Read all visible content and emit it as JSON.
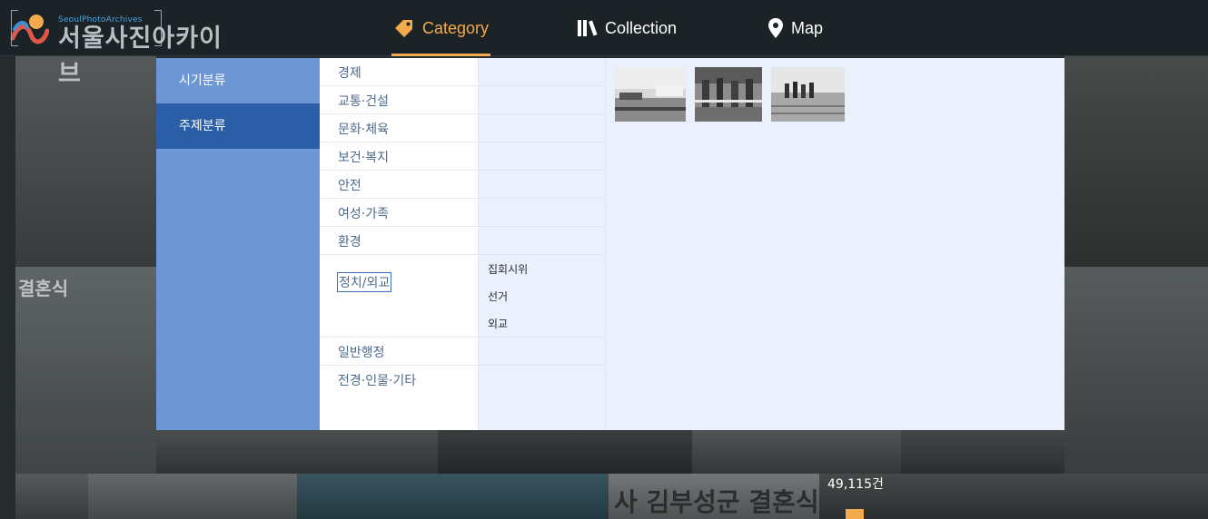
{
  "header": {
    "logo_small": "SeoulPhotoArchives",
    "logo_big": "서울사진아카이브",
    "nav": [
      {
        "label": "Category",
        "icon": "tag-icon",
        "active": true
      },
      {
        "label": "Collection",
        "icon": "books-icon",
        "active": false
      },
      {
        "label": "Map",
        "icon": "map-pin-icon",
        "active": false
      }
    ]
  },
  "dropdown": {
    "classifications": [
      "시기분류",
      "주제분류"
    ],
    "active_classification": "주제분류",
    "categories": [
      "경제",
      "교통·건설",
      "문화·체육",
      "보건·복지",
      "안전",
      "여성·가족",
      "환경",
      "정치/외교",
      "일반행정",
      "전경·인물·기타"
    ],
    "selected_category": "정치/외교",
    "subcategories": [
      "집회시위",
      "선거",
      "외교"
    ],
    "thumbnails": [
      "thumbnail-1",
      "thumbnail-2",
      "thumbnail-3"
    ]
  },
  "background": {
    "signs": [
      "결혼식",
      "사 김부성군 결혼식"
    ],
    "count_label": "49,115건"
  },
  "colors": {
    "accent": "#f4a94c",
    "header_bg": "#1c2326",
    "panel_bg": "#eaf1fc",
    "sidebar": "#6d97d4",
    "sidebar_active": "#2a5fa8",
    "category_text": "#4d6b8b"
  }
}
